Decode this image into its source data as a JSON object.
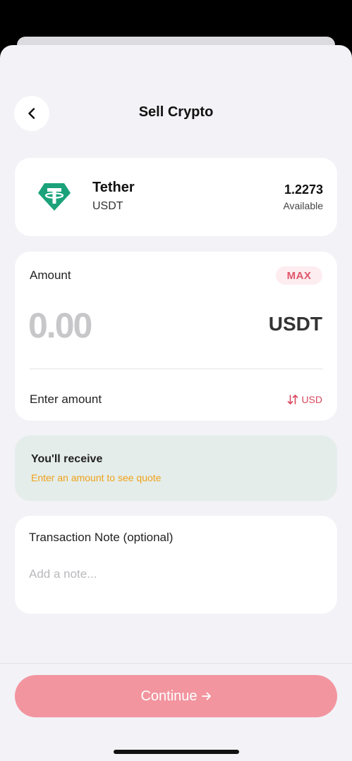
{
  "header": {
    "title": "Sell Crypto",
    "back_icon": "chevron-left-icon"
  },
  "asset": {
    "name": "Tether",
    "symbol": "USDT",
    "balance": "1.2273",
    "balance_label": "Available",
    "logo_icon": "tether-logo",
    "logo_color": "#1ba27a"
  },
  "amount": {
    "label": "Amount",
    "max_label": "MAX",
    "placeholder": "0.00",
    "unit": "USDT",
    "helper": "Enter amount",
    "switch_icon": "swap-vertical-icon",
    "switch_label": "USD"
  },
  "receive": {
    "title": "You'll receive",
    "hint": "Enter an amount to see quote"
  },
  "note": {
    "label": "Transaction Note (optional)",
    "placeholder": "Add a note..."
  },
  "footer": {
    "continue_label": "Continue",
    "continue_icon": "arrow-right-icon"
  },
  "colors": {
    "accent": "#e0576b",
    "button": "#f2959f",
    "receive_bg": "#e4ede9",
    "hint": "#f0a11a"
  }
}
